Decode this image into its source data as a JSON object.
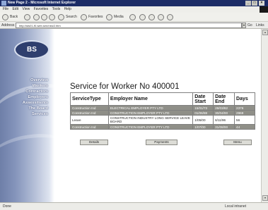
{
  "window": {
    "title": "New Page 2 - Microsoft Internet Explorer",
    "controls": [
      "_",
      "□",
      "×"
    ]
  },
  "menu": {
    "items": [
      "File",
      "Edit",
      "View",
      "Favorites",
      "Tools",
      "Help"
    ]
  },
  "toolbar": {
    "back_label": "Back",
    "search_label": "Search",
    "favorites_label": "Favorites",
    "media_label": "Media"
  },
  "address": {
    "label": "Address",
    "url": "http://sts01-f0.web.sen/new2.htm",
    "go_label": "Go",
    "links_label": "Links"
  },
  "sidebar": {
    "logo_text": "BS",
    "nav": [
      "Overview",
      "Workers",
      "Contractors",
      "Employers",
      "Assessments",
      "The Board",
      "Services"
    ]
  },
  "page": {
    "title": "Service for Worker No 400001",
    "columns": [
      "ServiceType",
      "Employer Name",
      "Date Start",
      "Date End",
      "Days"
    ],
    "rows": [
      {
        "type": "Construction Ind",
        "employer": "ELECTRICAL EMPLOYER PTY LTD",
        "start": "15/01/73",
        "end": "28/03/82",
        "days": "2376"
      },
      {
        "type": "Construction Ind",
        "employer": "CONSTRUCTION EMPLOYER PTY LTD",
        "start": "01/06/88",
        "end": "30/04/00",
        "days": "2969"
      },
      {
        "type": "Leave",
        "employer": "CONSTRUCTION INDUSTRY LONG SERVICE LEAVE BOARD",
        "start": "1/05/00",
        "end": "6/11/96",
        "days": "56"
      },
      {
        "type": "Construction Ind",
        "employer": "CONSTRUCTION EMPLOYER PTY LTD",
        "start": "1/07/00",
        "end": "31/08/00",
        "days": "44"
      }
    ],
    "buttons": {
      "details": "Details",
      "payments": "Payments",
      "menu": "Menu"
    }
  },
  "status": {
    "left": "Done",
    "right": "Local intranet"
  },
  "colors": {
    "titlebar": "#1c2c66",
    "row_shaded": "#8f8f88",
    "sidebar_blue": "#6e7fa8"
  }
}
